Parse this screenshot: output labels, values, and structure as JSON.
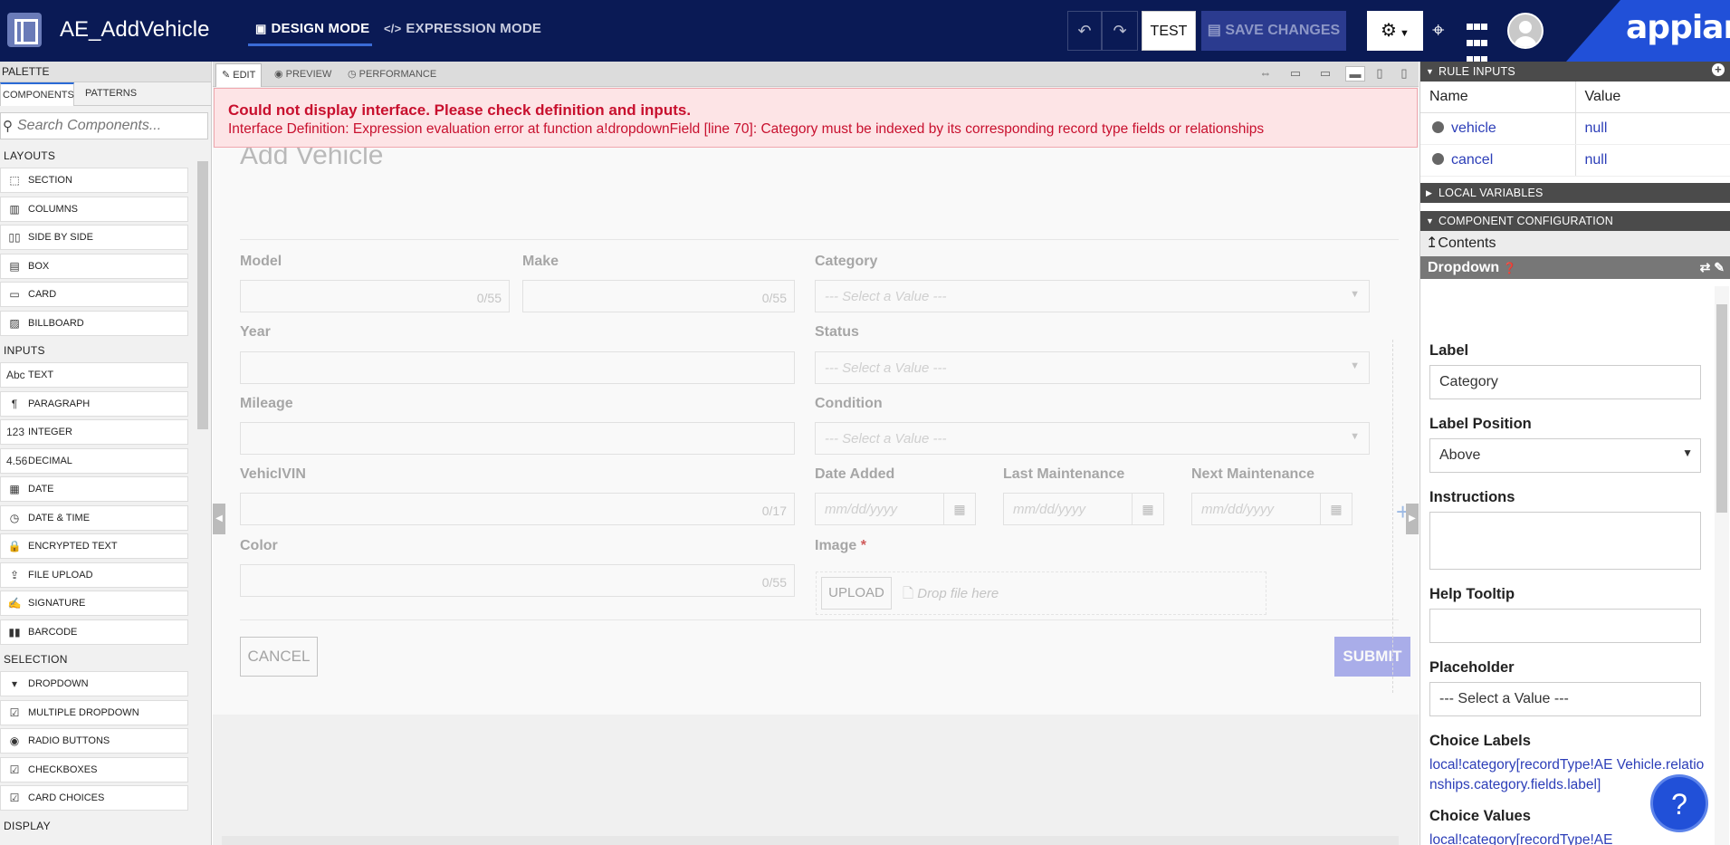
{
  "header": {
    "app_title": "AE_AddVehicle",
    "design_mode": "DESIGN MODE",
    "expression_mode": "EXPRESSION MODE",
    "test": "TEST",
    "save_changes": "SAVE CHANGES",
    "brand": "appian"
  },
  "palette": {
    "title": "PALETTE",
    "tabs": [
      "COMPONENTS",
      "PATTERNS"
    ],
    "search_placeholder": "Search Components...",
    "sections": [
      {
        "heading": "LAYOUTS",
        "items": [
          "SECTION",
          "COLUMNS",
          "SIDE BY SIDE",
          "BOX",
          "CARD",
          "BILLBOARD"
        ]
      },
      {
        "heading": "INPUTS",
        "items": [
          "TEXT",
          "PARAGRAPH",
          "INTEGER",
          "DECIMAL",
          "DATE",
          "DATE & TIME",
          "ENCRYPTED TEXT",
          "FILE UPLOAD",
          "SIGNATURE",
          "BARCODE"
        ]
      },
      {
        "heading": "SELECTION",
        "items": [
          "DROPDOWN",
          "MULTIPLE DROPDOWN",
          "RADIO BUTTONS",
          "CHECKBOXES",
          "CARD CHOICES"
        ]
      },
      {
        "heading": "DISPLAY",
        "items": []
      }
    ]
  },
  "canvas": {
    "tabs": [
      "EDIT",
      "PREVIEW",
      "PERFORMANCE"
    ],
    "error_title": "Could not display interface. Please check definition and inputs.",
    "error_message": "Interface Definition: Expression evaluation error at function a!dropdownField [line 70]: Category must be indexed by its corresponding record type fields or relationships",
    "form": {
      "title": "Add Vehicle",
      "model": "Model",
      "make": "Make",
      "category": "Category",
      "year": "Year",
      "status": "Status",
      "mileage": "Mileage",
      "condition": "Condition",
      "vin": "VehiclVIN",
      "date_added": "Date Added",
      "last_maintenance": "Last Maintenance",
      "next_maintenance": "Next Maintenance",
      "color": "Color",
      "image": "Image",
      "counter_55": "0/55",
      "counter_17": "0/17",
      "select_placeholder": "--- Select a Value ---",
      "date_placeholder": "mm/dd/yyyy",
      "upload": "UPLOAD",
      "drop_file": "Drop file here",
      "cancel": "CANCEL",
      "submit": "SUBMIT"
    }
  },
  "right_panel": {
    "rule_inputs": "RULE INPUTS",
    "col_name": "Name",
    "col_value": "Value",
    "inputs": [
      {
        "name": "vehicle",
        "value": "null"
      },
      {
        "name": "cancel",
        "value": "null"
      }
    ],
    "local_variables": "LOCAL VARIABLES",
    "component_configuration": "COMPONENT CONFIGURATION",
    "contents": "Contents",
    "component": "Dropdown",
    "label_label": "Label",
    "label_value": "Category",
    "label_position_label": "Label Position",
    "label_position_value": "Above",
    "instructions_label": "Instructions",
    "help_tooltip_label": "Help Tooltip",
    "placeholder_label": "Placeholder",
    "placeholder_value": "--- Select a Value ---",
    "choice_labels_label": "Choice Labels",
    "choice_labels_value": "local!category[recordType!AE Vehicle.relationships.category.fields.label]",
    "choice_values_label": "Choice Values",
    "choice_values_value": "local!category[recordType!AE"
  },
  "colors": {
    "header_bg": "#0a1a55",
    "brand_blue": "#2150d8",
    "error_red": "#c8102e",
    "link_blue": "#2c3eb8"
  }
}
